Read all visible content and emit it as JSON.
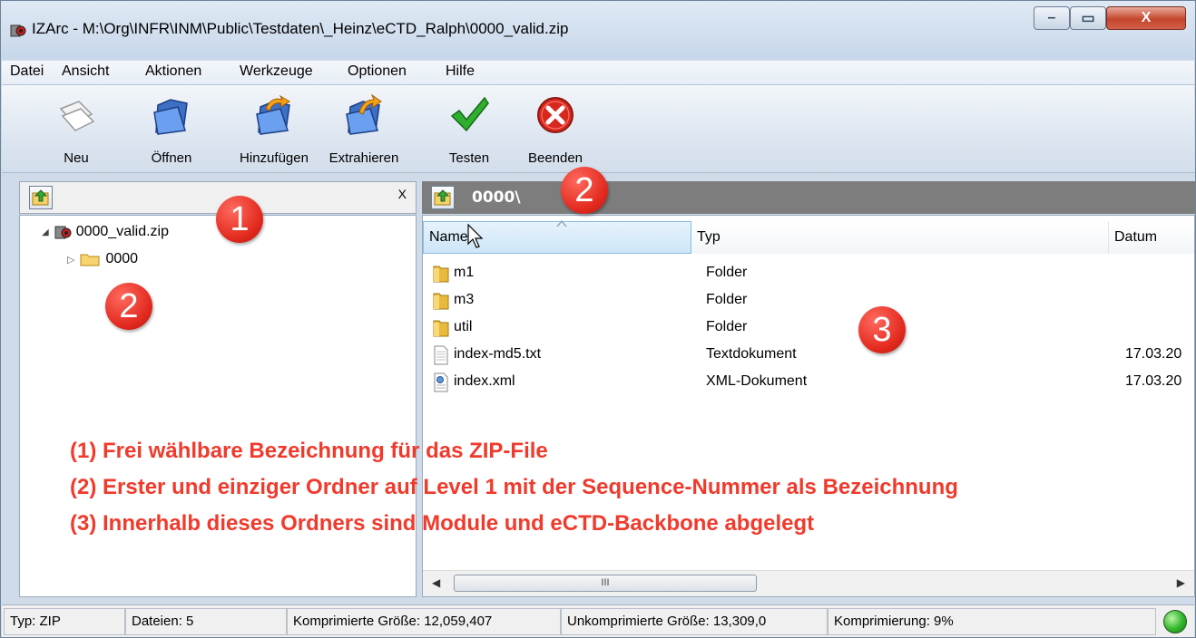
{
  "window": {
    "title": "IZArc - M:\\Org\\INFR\\INM\\Public\\Testdaten\\_Heinz\\eCTD_Ralph\\0000_valid.zip",
    "min_symbol": "–",
    "max_symbol": "▭",
    "close_symbol": "X"
  },
  "menu": [
    "Datei",
    "Ansicht",
    "Aktionen",
    "Werkzeuge",
    "Optionen",
    "Hilfe"
  ],
  "toolbar": [
    {
      "label": "Neu",
      "icon": "new-archive-icon"
    },
    {
      "label": "Öffnen",
      "icon": "open-folder-icon"
    },
    {
      "label": "Hinzufügen",
      "icon": "add-icon"
    },
    {
      "label": "Extrahieren",
      "icon": "extract-icon"
    },
    {
      "label": "Testen",
      "icon": "check-icon"
    },
    {
      "label": "Beenden",
      "icon": "exit-icon"
    }
  ],
  "left_pane": {
    "close_label": "X",
    "tree": [
      {
        "label": "0000_valid.zip",
        "expander": "◢"
      },
      {
        "label": "0000",
        "expander": "▷"
      }
    ]
  },
  "right_pane": {
    "path": "0000\\",
    "columns": [
      "Name",
      "Typ",
      "Datum"
    ],
    "rows": [
      {
        "name": "m1",
        "type": "Folder",
        "date": "",
        "icon": "folder-icon"
      },
      {
        "name": "m3",
        "type": "Folder",
        "date": "",
        "icon": "folder-icon"
      },
      {
        "name": "util",
        "type": "Folder",
        "date": "",
        "icon": "folder-icon"
      },
      {
        "name": "index-md5.txt",
        "type": "Textdokument",
        "date": "17.03.20",
        "icon": "text-file-icon"
      },
      {
        "name": "index.xml",
        "type": "XML-Dokument",
        "date": "17.03.20",
        "icon": "xml-file-icon"
      }
    ],
    "scroll_thumb": "III"
  },
  "status": {
    "type": "Typ: ZIP",
    "files": "Dateien: 5",
    "compressed": "Komprimierte Größe: 12,059,407",
    "uncompressed": "Unkomprimierte Größe: 13,309,0",
    "ratio": "Komprimierung: 9%"
  },
  "annotations": {
    "badges": [
      "1",
      "2",
      "2",
      "3"
    ],
    "lines": [
      "(1) Frei wählbare Bezeichnung für das ZIP-File",
      "(2) Erster und einziger Ordner auf Level 1 mit der Sequence-Nummer als Bezeichnung",
      "(3) Innerhalb dieses Ordners sind Module und eCTD-Backbone abgelegt"
    ]
  },
  "colors": {
    "annotation_red": "#f03a2c",
    "badge_red": "#e2291e",
    "path_bar": "#7d7d7d",
    "selection": "#cde6f7"
  }
}
